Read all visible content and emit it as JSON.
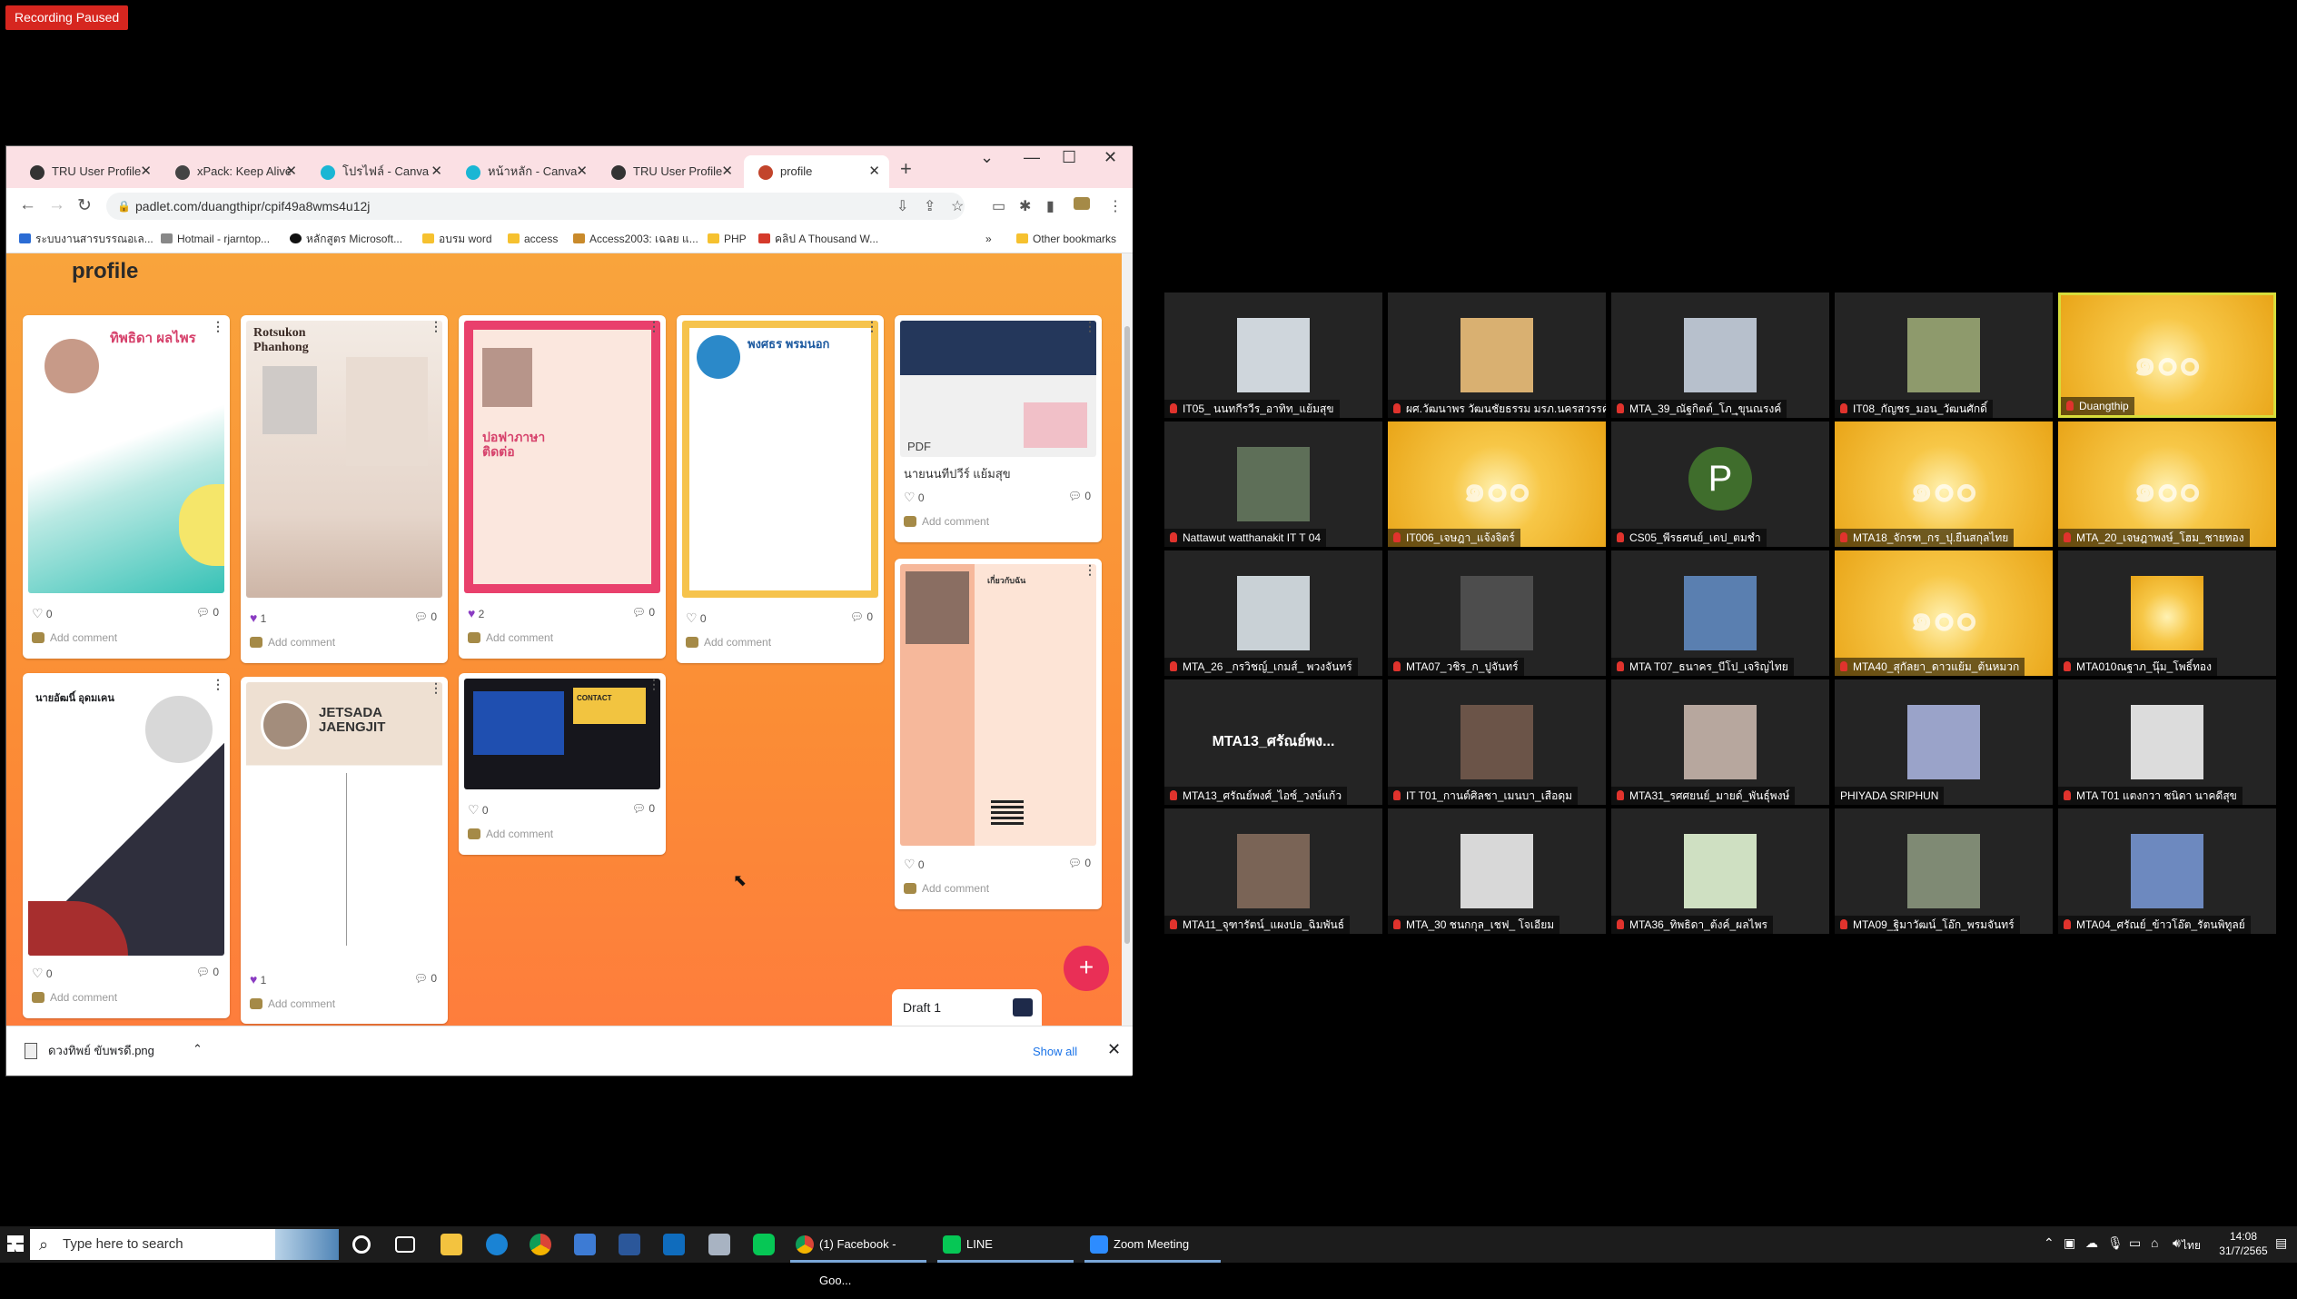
{
  "recording": {
    "label": "Recording Paused"
  },
  "browser": {
    "tabs": [
      {
        "label": "TRU User Profile",
        "icon": "tru-icon"
      },
      {
        "label": "xPack: Keep Alive",
        "icon": "extension-icon"
      },
      {
        "label": "โปรไฟล์ - Canva",
        "icon": "canva-icon"
      },
      {
        "label": "หน้าหลัก - Canva",
        "icon": "canva-icon"
      },
      {
        "label": "TRU User Profile",
        "icon": "tru-icon"
      },
      {
        "label": "profile",
        "icon": "padlet-icon",
        "active": true
      }
    ],
    "new_tab": "+",
    "url": "padlet.com/duangthipr/cpif49a8wms4u12j",
    "bookmarks": [
      "ระบบงานสารบรรณอเล...",
      "Hotmail - rjarntop...",
      "หลักสูตร Microsoft...",
      "อบรม word",
      "access",
      "Access2003: เฉลย แ...",
      "PHP",
      "คลิป A Thousand W..."
    ],
    "other_bookmarks": "Other bookmarks",
    "page_title": "profile",
    "cards": [
      {
        "likes": "0",
        "comments": "0",
        "add": "Add comment",
        "title": "ทิพธิดา ผลไพร"
      },
      {
        "likes": "1",
        "comments": "0",
        "add": "Add comment",
        "title": "Rotsukon Phanhong"
      },
      {
        "likes": "2",
        "comments": "0",
        "add": "Add comment",
        "title": "ปอฟาภาษา ติดต่อ"
      },
      {
        "likes": "0",
        "comments": "0",
        "add": "Add comment",
        "title": "พงศธร พรมนอก"
      },
      {
        "likes": "0",
        "comments": "0",
        "add": "Add comment",
        "title": "",
        "caption": "นายนนทีปวีร์ แย้มสุข",
        "pdf": "PDF"
      },
      {
        "likes": "0",
        "comments": "0",
        "add": "Add comment",
        "title": "นายอัฒนิ์ อุดมเคน"
      },
      {
        "likes": "1",
        "comments": "0",
        "add": "Add comment",
        "title": "JETSADA JAENGJIT"
      },
      {
        "likes": "0",
        "comments": "0",
        "add": "Add comment",
        "title": "CONTACT"
      },
      {
        "likes": "0",
        "comments": "0",
        "add": "Add comment",
        "title": "เกี่ยวกับฉัน"
      }
    ],
    "draft": "Draft 1",
    "fab": "+",
    "download": {
      "file": "ดวงทิพย์ ขับพรดี.png",
      "show_all": "Show all",
      "close": "✕"
    }
  },
  "zoom": {
    "participants": [
      "IT05_ นนทกีรวีร_อาทิท_แย้มสุข",
      "ผศ.วัฒนาพร วัฒนชัยธรรม มรภ.นครสวรรค์",
      "MTA_39_ณัฐกิตต์_โภ_ุขุนณรงค์",
      "IT08_กัญชร_มอน_วัฒนศักดิ์",
      "Duangthip",
      "Nattawut watthanakit IT T 04",
      "IT006_เจษฎา_แจ้งจิตร์",
      "CS05_พีรธศนย์_เดป_ตมชำ",
      "MTA18_จักรฑ_กร_ปุ.ยืนสกุลไทย",
      "MTA_20_เจษฎาพงษ์_โฮม_ชายทอง",
      "MTA_26 _กรวิชญ์_เกมส์_ พวงจันทร์",
      "MTA07_วชิร_ก_ปูจันทร์",
      "MTA T07_ธนาคร_บีโป_เจริญไทย",
      "MTA40_สุกัลยา_ดาวแย้ม_ต้นหมวก",
      "MTA010ณฐาภ_นุ๊ม_โพธิ์ทอง",
      "MTA13_ศรัณย์พงศ์_ไอซ์_วงษ์แก้ว",
      "IT T01_กานต์ศิลชา_เมนบา_เสือดุม",
      "MTA31_รศศยนย์_มายด์_พันธุ์พงษ์",
      "PHIYADA SRIPHUN",
      "MTA T01 แตงกวา ชนิดา นาคดีสุข",
      "MTA11_จุฑารัตน์_แผงปอ_ฉิมพันธ์",
      "MTA_30 ชนกกุล_เชฟ_ โจเอียม",
      "MTA36_ทิพธิดา_ต้งค์_ผลไพร",
      "MTA09_ฐิมาวัฒน์_โอ๊ก_พรมจันทร์",
      "MTA04_ศรัณย์_ข้าวโอ๊ต_รัตนพิทูลย์"
    ],
    "big_name": "MTA13_ศรัณย์พง...",
    "avatar_letter": "P"
  },
  "taskbar": {
    "search": "Type here to search",
    "apps": [
      {
        "label": "(1) Facebook - Goo..."
      },
      {
        "label": "LINE"
      },
      {
        "label": "Zoom Meeting"
      }
    ],
    "lang": "ไทย",
    "time": "14:08",
    "date": "31/7/2565"
  }
}
